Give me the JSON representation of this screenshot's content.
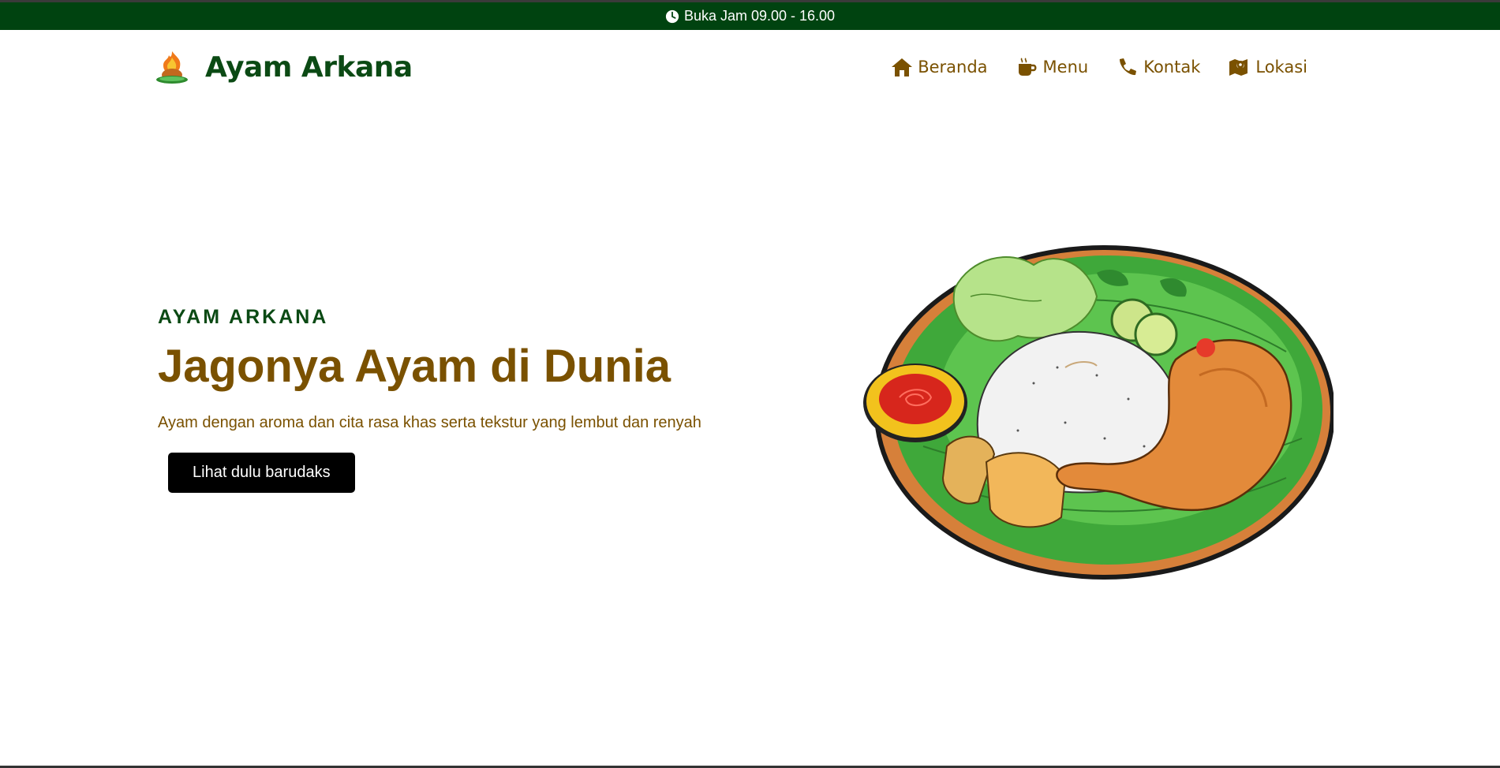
{
  "topbar": {
    "hours_text": "Buka Jam 09.00 - 16.00",
    "icon": "clock-icon",
    "background": "#004310"
  },
  "brand": {
    "name": "Ayam Arkana",
    "logo": "roast-chicken-logo"
  },
  "nav": {
    "items": [
      {
        "label": "Beranda",
        "icon": "home-icon"
      },
      {
        "label": "Menu",
        "icon": "coffee-cup-icon"
      },
      {
        "label": "Kontak",
        "icon": "phone-icon"
      },
      {
        "label": "Lokasi",
        "icon": "map-marker-icon"
      }
    ]
  },
  "hero": {
    "eyebrow": "AYAM ARKANA",
    "headline": "Jagonya Ayam di Dunia",
    "tagline": "Ayam dengan aroma dan cita rasa khas serta tekstur yang lembut dan renyah",
    "cta_label": "Lihat dulu barudaks",
    "image": "nasi-ayam-plate-illustration"
  },
  "colors": {
    "brand_green": "#0b4a14",
    "accent_brown": "#7a5100",
    "button_bg": "#000000"
  }
}
